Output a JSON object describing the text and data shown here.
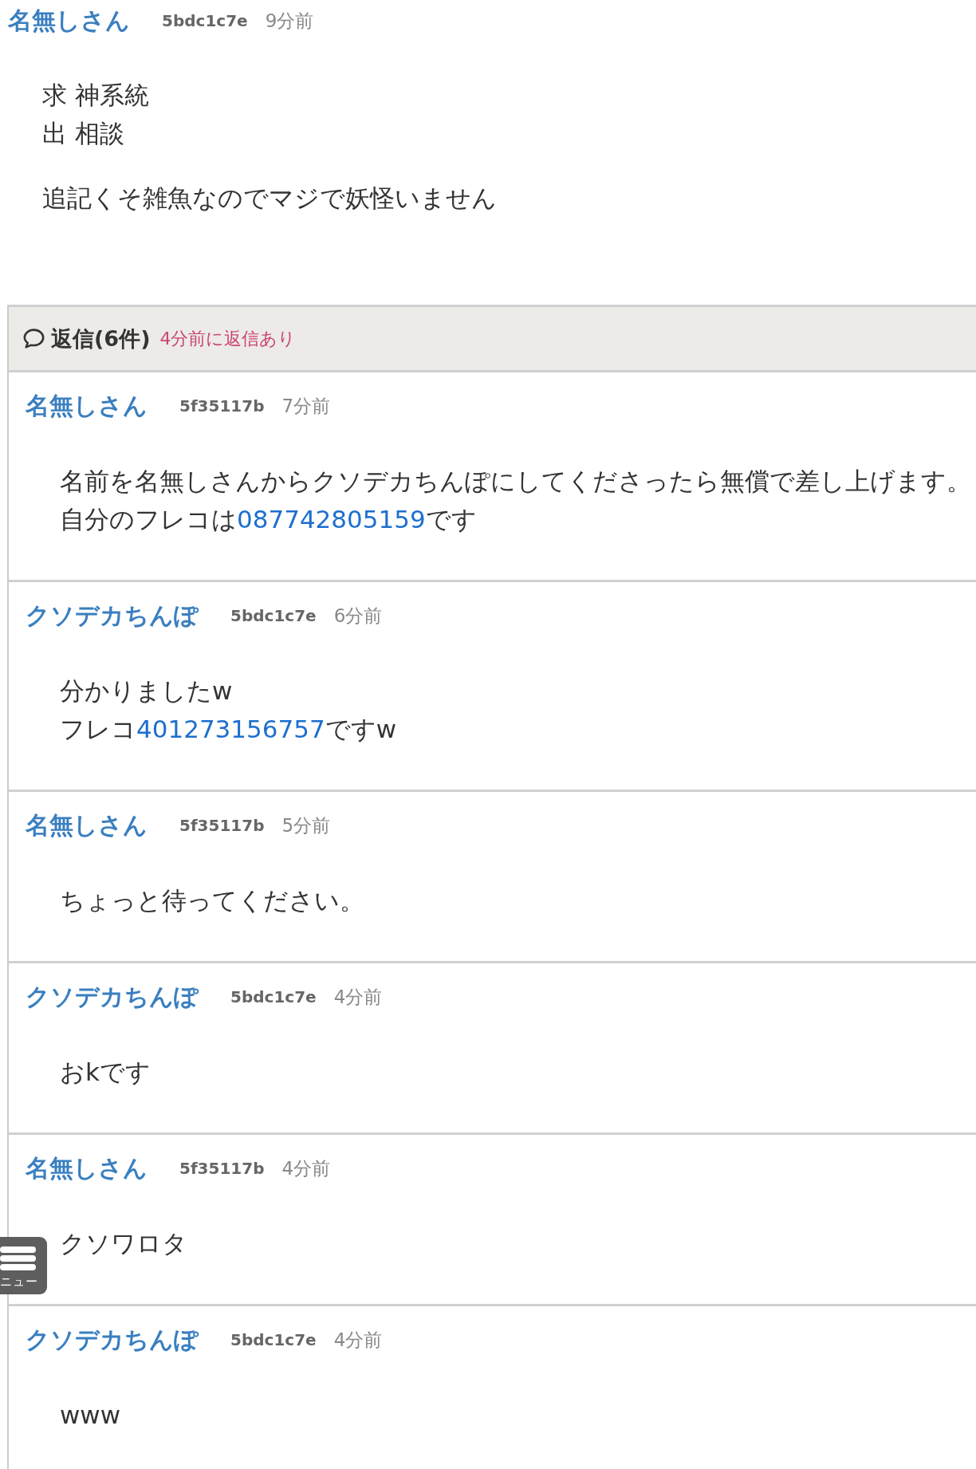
{
  "post": {
    "author": "名無しさん",
    "id": "5bdc1c7e",
    "time": "9分前",
    "paragraphs": [
      {
        "lines": [
          "求 神系統",
          "出 相談"
        ]
      },
      {
        "lines": [
          "追記くそ雑魚なのでマジで妖怪いません"
        ]
      }
    ]
  },
  "replies_section": {
    "title": "返信(6件)",
    "last_reply": "4分前に返信あり"
  },
  "replies": [
    {
      "author": "名無しさん",
      "id": "5f35117b",
      "time": "7分前",
      "lines": [
        [
          {
            "kind": "text",
            "text": "名前を名無しさんからクソデカちんぽにしてくださったら無償で差し上げます。"
          }
        ],
        [
          {
            "kind": "text",
            "text": "自分のフレコは"
          },
          {
            "kind": "link",
            "text": "087742805159"
          },
          {
            "kind": "text",
            "text": "です"
          }
        ]
      ]
    },
    {
      "author": "クソデカちんぽ",
      "id": "5bdc1c7e",
      "time": "6分前",
      "lines": [
        [
          {
            "kind": "text",
            "text": "分かりましたw"
          }
        ],
        [
          {
            "kind": "text",
            "text": "フレコ"
          },
          {
            "kind": "link",
            "text": "401273156757"
          },
          {
            "kind": "text",
            "text": "ですw"
          }
        ]
      ]
    },
    {
      "author": "名無しさん",
      "id": "5f35117b",
      "time": "5分前",
      "lines": [
        [
          {
            "kind": "text",
            "text": "ちょっと待ってください。"
          }
        ]
      ]
    },
    {
      "author": "クソデカちんぽ",
      "id": "5bdc1c7e",
      "time": "4分前",
      "lines": [
        [
          {
            "kind": "text",
            "text": "おkです"
          }
        ]
      ]
    },
    {
      "author": "名無しさん",
      "id": "5f35117b",
      "time": "4分前",
      "lines": [
        [
          {
            "kind": "text",
            "text": "クソワロタ"
          }
        ]
      ]
    },
    {
      "author": "クソデカちんぽ",
      "id": "5bdc1c7e",
      "time": "4分前",
      "lines": [
        [
          {
            "kind": "text",
            "text": "www"
          }
        ]
      ]
    }
  ],
  "menu_button": {
    "label": "ニュー"
  }
}
